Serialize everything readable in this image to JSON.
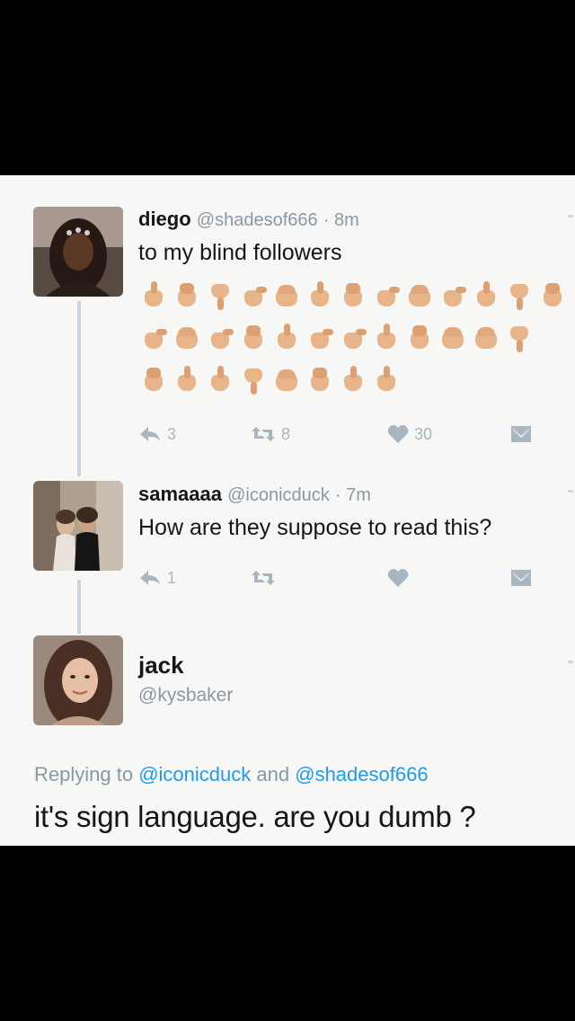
{
  "tweets": [
    {
      "name": "diego",
      "handle": "@shadesof666",
      "time": "· 8m",
      "text": "to my blind followers",
      "emoji_rows": [
        13,
        12,
        8
      ],
      "reply_count": "3",
      "retweet_count": "8",
      "like_count": "30"
    },
    {
      "name": "samaaaa",
      "handle": "@iconicduck",
      "time": "· 7m",
      "text": "How are they suppose to read this?",
      "reply_count": "1",
      "retweet_count": "",
      "like_count": ""
    }
  ],
  "reply": {
    "name": "jack",
    "handle": "@kysbaker",
    "replying_prefix": "Replying to",
    "mention_1": "@iconicduck",
    "and_word": "and",
    "mention_2": "@shadesof666",
    "text": "it's sign language. are you dumb ?"
  },
  "icons": [
    "reply-icon",
    "retweet-icon",
    "heart-icon",
    "dm-icon"
  ],
  "colors": {
    "accent": "#1d9bf0",
    "muted": "#8899a6",
    "icon": "#a8b6c0",
    "text": "#14171a",
    "background": "#f7f7f5",
    "frame": "#000000"
  }
}
